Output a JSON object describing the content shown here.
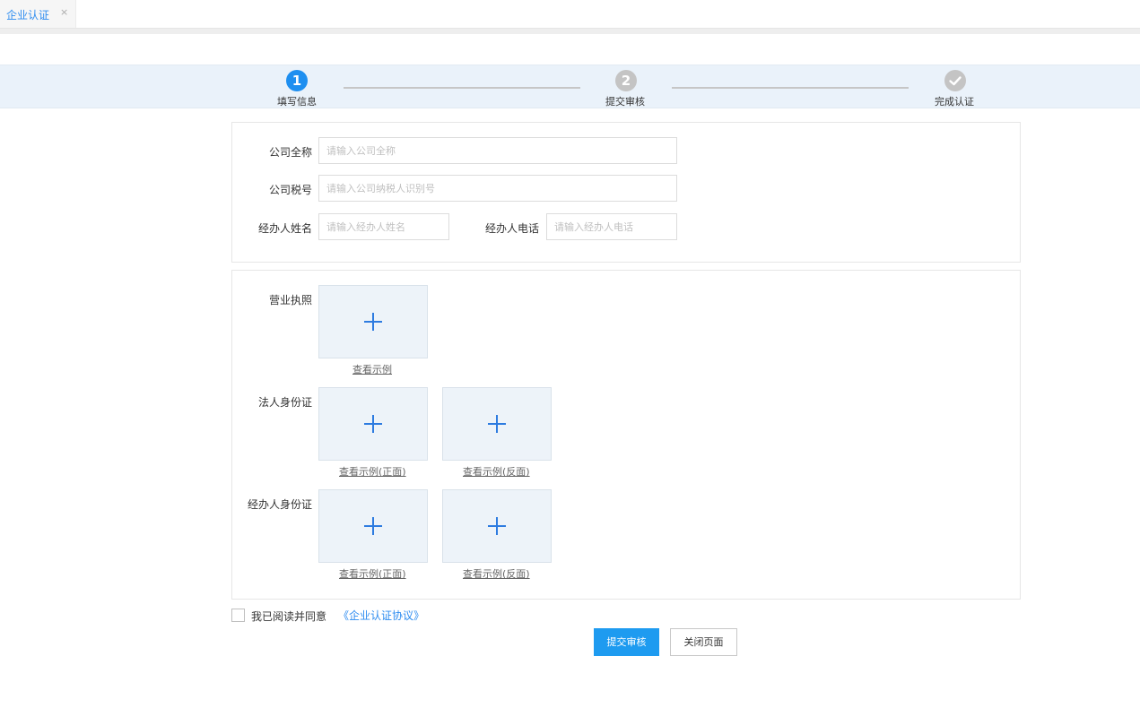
{
  "tab": {
    "label": "企业认证",
    "close": "×"
  },
  "steps": [
    {
      "number": "1",
      "label": "填写信息",
      "state": "active",
      "color": "#1e8ff0"
    },
    {
      "number": "2",
      "label": "提交审核",
      "state": "pending",
      "color": "#c4c4c4"
    },
    {
      "number": "",
      "label": "完成认证",
      "state": "pending",
      "color": "#c4c4c4",
      "icon": "check-icon"
    }
  ],
  "form": {
    "company_name": {
      "label": "公司全称",
      "placeholder": "请输入公司全称",
      "value": ""
    },
    "company_tax": {
      "label": "公司税号",
      "placeholder": "请输入公司纳税人识别号",
      "value": ""
    },
    "agent_name": {
      "label": "经办人姓名",
      "placeholder": "请输入经办人姓名",
      "value": ""
    },
    "agent_phone": {
      "label": "经办人电话",
      "placeholder": "请输入经办人电话",
      "value": ""
    }
  },
  "uploads": {
    "license": {
      "label": "营业执照",
      "sample": "查看示例"
    },
    "legal_id": {
      "label": "法人身份证",
      "sample_front": "查看示例(正面)",
      "sample_back": "查看示例(反面)"
    },
    "agent_id": {
      "label": "经办人身份证",
      "sample_front": "查看示例(正面)",
      "sample_back": "查看示例(反面)"
    }
  },
  "agreement": {
    "text": "我已阅读并同意",
    "link": "《企业认证协议》",
    "checked": false
  },
  "buttons": {
    "submit": "提交审核",
    "close": "关闭页面"
  },
  "colors": {
    "accent": "#1e9bf0",
    "link": "#2d8cf0",
    "upload_bg": "#edf3f9",
    "plus": "#2d7be0"
  }
}
